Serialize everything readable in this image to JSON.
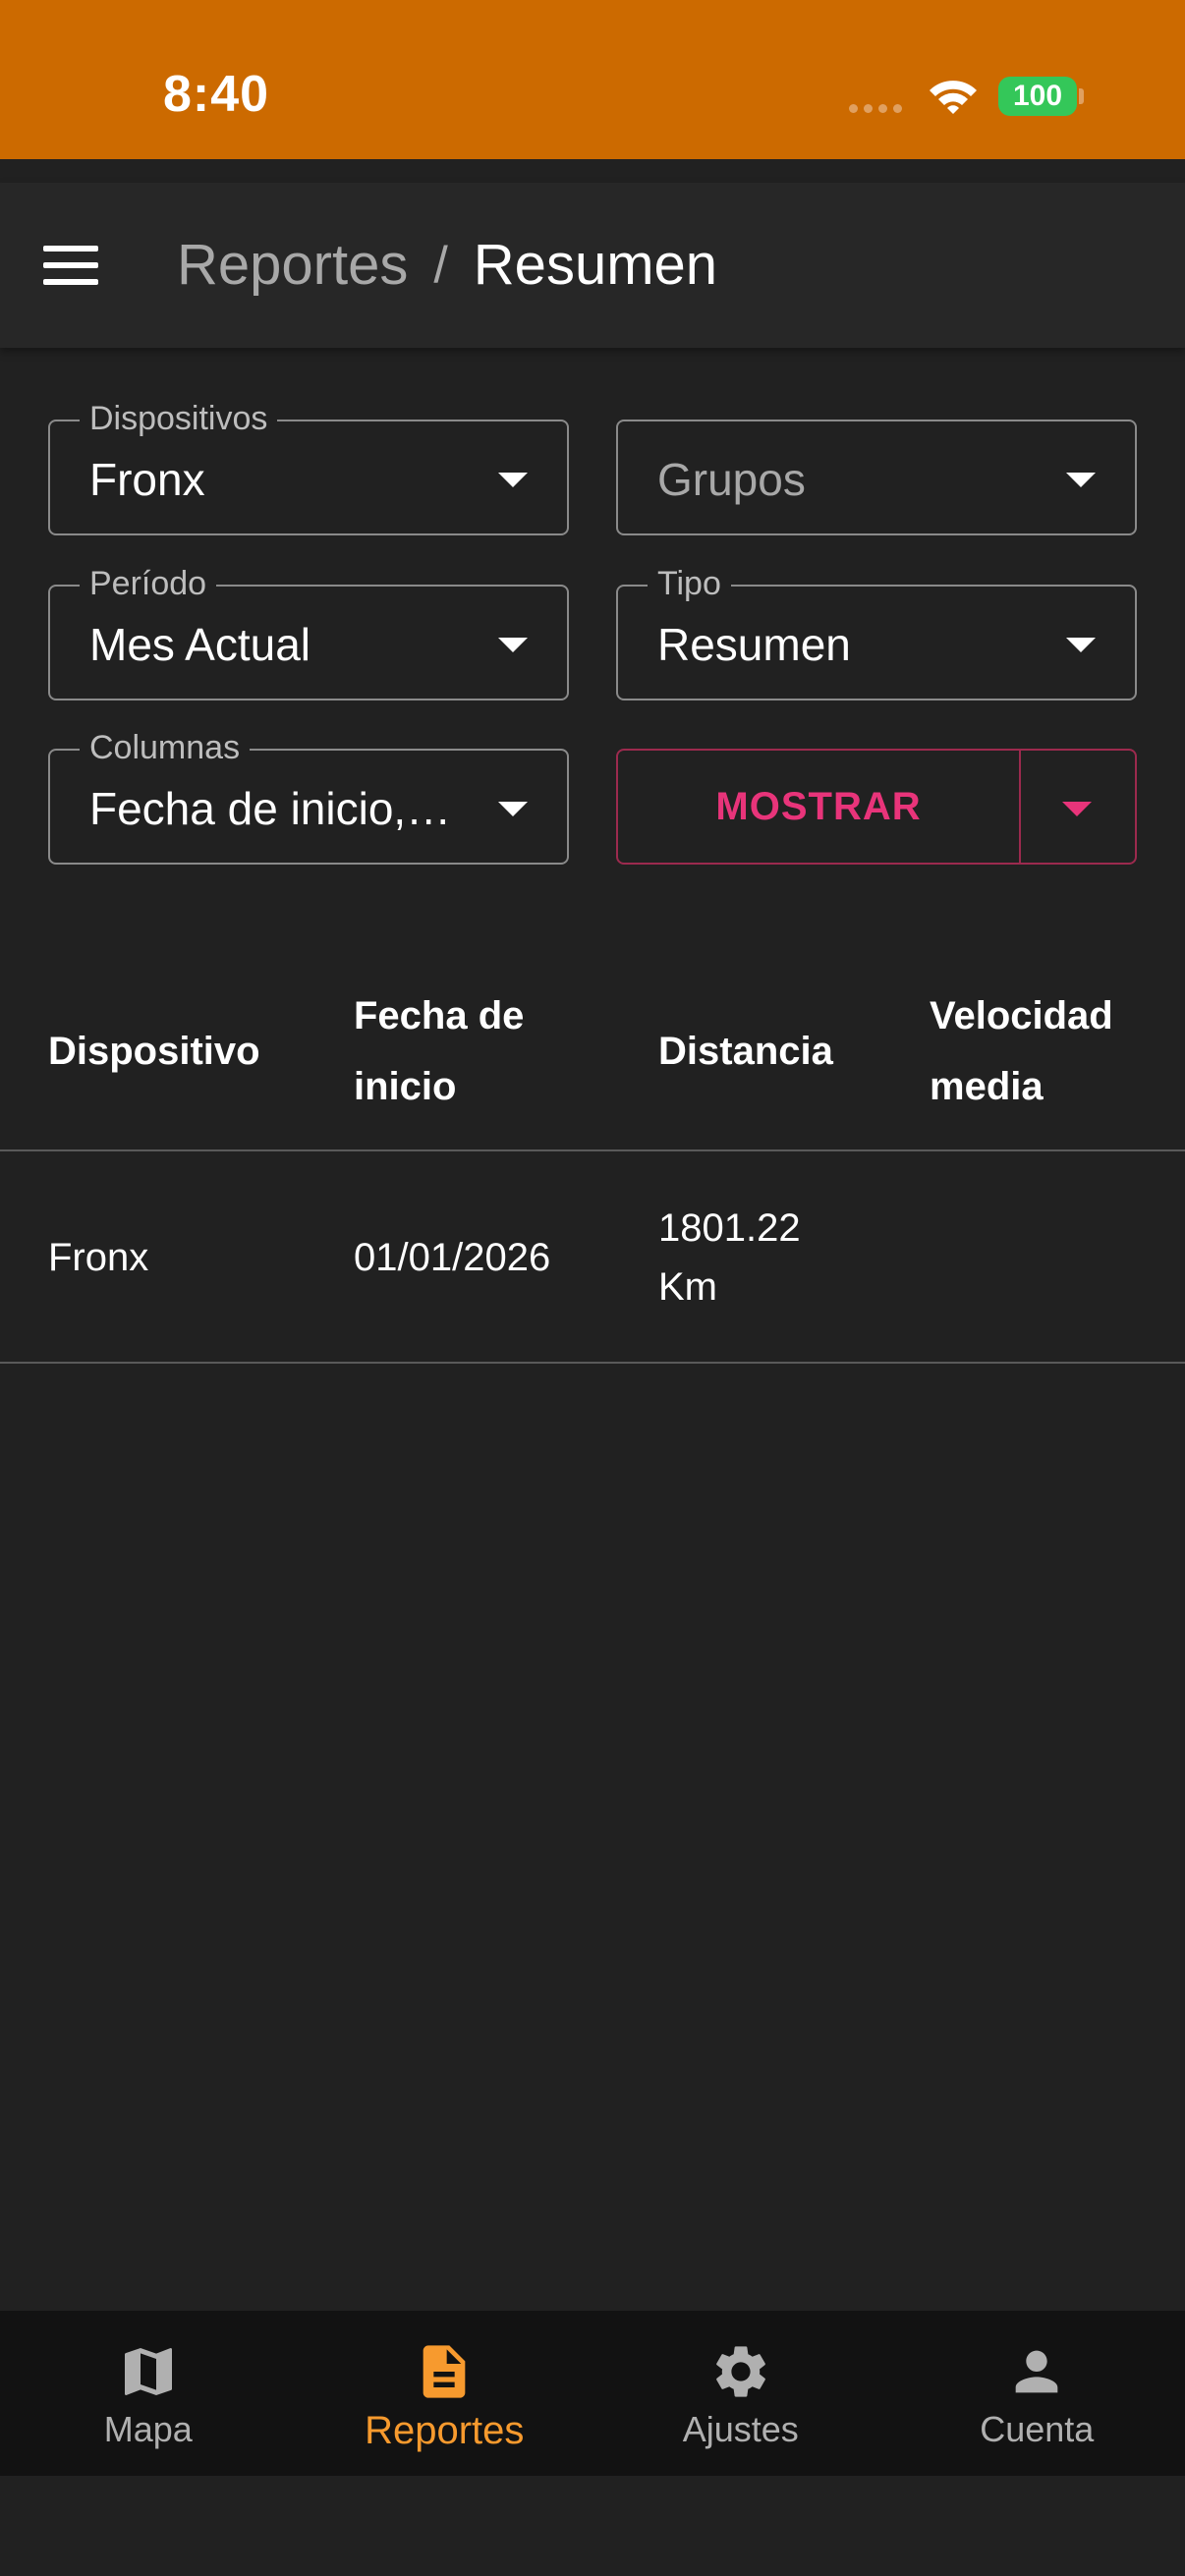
{
  "status_bar": {
    "time": "8:40",
    "battery": "100",
    "color": "#cc6a00"
  },
  "app_bar": {
    "breadcrumb_parent": "Reportes",
    "breadcrumb_separator": "/",
    "breadcrumb_current": "Resumen"
  },
  "filters": {
    "dispositivos": {
      "label": "Dispositivos",
      "value": "Fronx"
    },
    "grupos": {
      "placeholder": "Grupos"
    },
    "periodo": {
      "label": "Período",
      "value": "Mes Actual"
    },
    "tipo": {
      "label": "Tipo",
      "value": "Resumen"
    },
    "columnas": {
      "label": "Columnas",
      "value": "Fecha de inicio,…"
    }
  },
  "show_button": {
    "label": "MOSTRAR",
    "color": "#e8347a"
  },
  "table": {
    "headers": [
      "Dispositivo",
      "Fecha de\ninicio",
      "Distancia",
      "Velocidad\nmedia"
    ],
    "rows": [
      [
        "Fronx",
        "01/01/2026",
        "1801.22\nKm",
        ""
      ]
    ]
  },
  "bottom_nav": {
    "items": [
      {
        "label": "Mapa",
        "icon": "map-icon"
      },
      {
        "label": "Reportes",
        "icon": "report-icon",
        "active": true
      },
      {
        "label": "Ajustes",
        "icon": "gear-icon"
      },
      {
        "label": "Cuenta",
        "icon": "person-icon"
      }
    ],
    "active_color": "#f79a2e"
  }
}
